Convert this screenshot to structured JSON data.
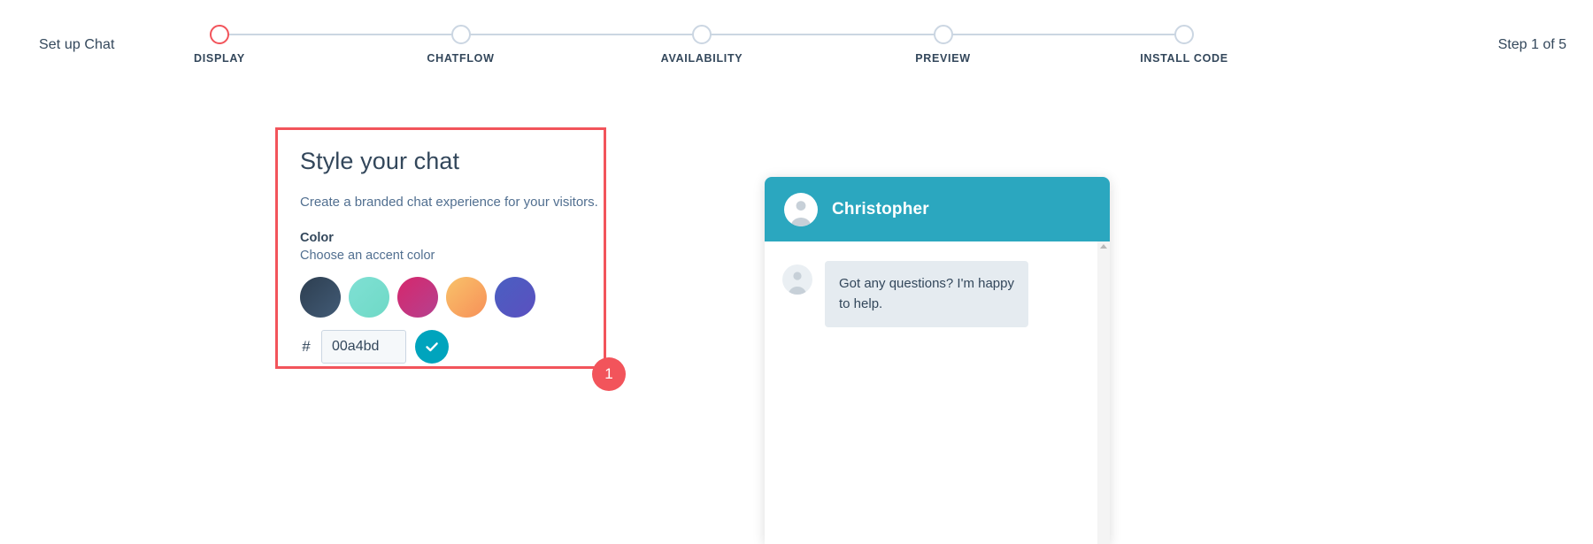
{
  "header": {
    "setup_title": "Set up Chat",
    "step_counter": "Step 1 of 5",
    "steps": [
      {
        "label": "DISPLAY",
        "active": true
      },
      {
        "label": "CHATFLOW",
        "active": false
      },
      {
        "label": "AVAILABILITY",
        "active": false
      },
      {
        "label": "PREVIEW",
        "active": false
      },
      {
        "label": "INSTALL CODE",
        "active": false
      }
    ],
    "active_color": "#f2545b",
    "inactive_color": "#cbd6e2"
  },
  "style_card": {
    "title": "Style your chat",
    "subtitle": "Create a branded chat experience for your visitors.",
    "color_label": "Color",
    "color_hint": "Choose an accent color",
    "swatches": [
      {
        "name": "swatch-dark-navy",
        "from": "#2d3e50",
        "to": "#425b76"
      },
      {
        "name": "swatch-mint-teal",
        "from": "#7fe0d4",
        "to": "#6fd9c6"
      },
      {
        "name": "swatch-magenta-pink",
        "from": "#d6276c",
        "to": "#b5418f"
      },
      {
        "name": "swatch-orange-yellow",
        "from": "#f8c26a",
        "to": "#f79058"
      },
      {
        "name": "swatch-blue-purple",
        "from": "#4a5fc1",
        "to": "#5b50c0"
      }
    ],
    "hex_prefix": "#",
    "hex_value": "00a4bd",
    "hex_placeholder": "000000",
    "confirm_icon": "check-icon",
    "highlight_color": "#f2545b"
  },
  "step_badge": {
    "number": "1"
  },
  "chat_preview": {
    "agent_name": "Christopher",
    "header_color": "#2ba7bf",
    "avatar_icon": "person-avatar-icon",
    "messages": [
      {
        "text": "Got any questions? I'm happy to help."
      }
    ]
  }
}
